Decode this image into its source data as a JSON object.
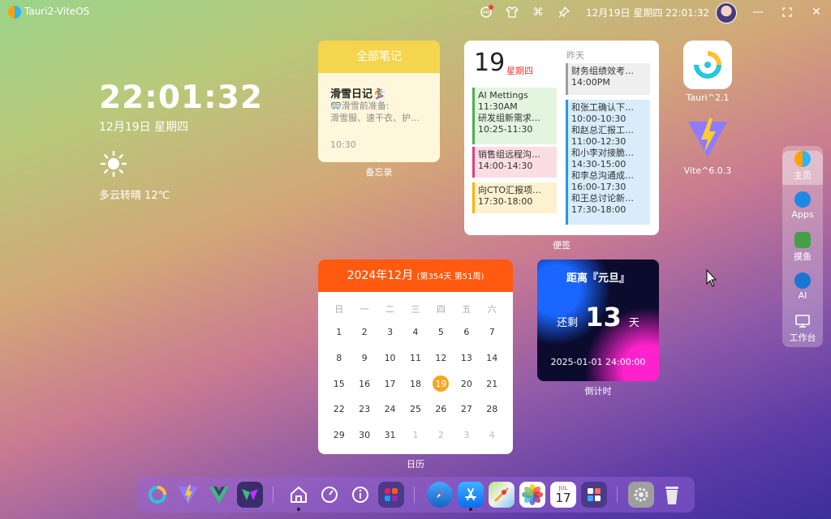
{
  "app": {
    "title": "Tauri2-ViteOS"
  },
  "topbar": {
    "datetime": "12月19日 星期四 22:01:32"
  },
  "clock": {
    "time": "22:01:32",
    "date": "12月19日 星期四",
    "weather": "多云转晴 12℃"
  },
  "notes": {
    "header": "全部笔记",
    "title": "滑雪日记🏂",
    "line1": "🥽滑雪前准备:",
    "line2": "滑雪服、速干衣、护…",
    "time": "10:30",
    "label": "备忘录"
  },
  "schedule": {
    "day": "19",
    "weekday": "星期四",
    "yesterday": "昨天",
    "label": "便签",
    "today_events": [
      {
        "lines": [
          "AI Mettings",
          "11:30AM",
          "研发组新需求…",
          "10:25-11:30"
        ],
        "color": "#4caf50",
        "bg": "#e3f5df"
      },
      {
        "lines": [
          "销售组远程沟…",
          "14:00-14:30"
        ],
        "color": "#e0407a",
        "bg": "#fbdde6"
      },
      {
        "lines": [
          "向CTO汇报项…",
          "17:30-18:00"
        ],
        "color": "#f5b400",
        "bg": "#fdf1cf"
      }
    ],
    "yesterday_events": [
      {
        "lines": [
          "财务组绩效考…",
          "14:00PM"
        ],
        "color": "#9e9e9e",
        "bg": "#efefef"
      },
      {
        "lines": [
          "和张工确认下…",
          "10:00-10:30",
          "和赵总汇报工…",
          "11:00-12:30",
          "和小李对接脆…",
          "14:30-15:00",
          "和李总沟通成…",
          "16:00-17:30",
          "和王总讨论新…",
          "17:30-18:00"
        ],
        "color": "#2196f3",
        "bg": "#d8ecfa"
      }
    ]
  },
  "calendar": {
    "title": "2024年12月",
    "sub": "(第354天 第51周)",
    "label": "日历",
    "weekdays": [
      "日",
      "一",
      "二",
      "三",
      "四",
      "五",
      "六"
    ],
    "days": [
      "1",
      "2",
      "3",
      "4",
      "5",
      "6",
      "7",
      "8",
      "9",
      "10",
      "11",
      "12",
      "13",
      "14",
      "15",
      "16",
      "17",
      "18",
      "19",
      "20",
      "21",
      "22",
      "23",
      "24",
      "25",
      "26",
      "27",
      "28",
      "29",
      "30",
      "31",
      "1",
      "2",
      "3",
      "4"
    ],
    "today": "19"
  },
  "countdown": {
    "title": "距离『元旦』",
    "prefix": "还剩",
    "days": "13",
    "suffix": "天",
    "target": "2025-01-01 24:00:00",
    "label": "倒计时"
  },
  "desktop_apps": [
    {
      "label": "Tauri^2.1"
    },
    {
      "label": "Vite^6.0.3"
    }
  ],
  "side_dock": [
    {
      "label": "主页"
    },
    {
      "label": "Apps"
    },
    {
      "label": "摸鱼"
    },
    {
      "label": "AI"
    },
    {
      "label": "工作台"
    }
  ],
  "dock_icons": [
    "tauri-icon",
    "vite-icon",
    "vue-icon",
    "viteos-icon",
    "home-icon",
    "dashboard-icon",
    "info-icon",
    "apps-folder-icon",
    "safari-icon",
    "app-store-icon",
    "maps-icon",
    "photos-icon",
    "calendar-icon",
    "launchpad-icon",
    "settings-icon",
    "trash-icon"
  ],
  "dock_calendar": {
    "month": "JUL",
    "day": "17"
  }
}
